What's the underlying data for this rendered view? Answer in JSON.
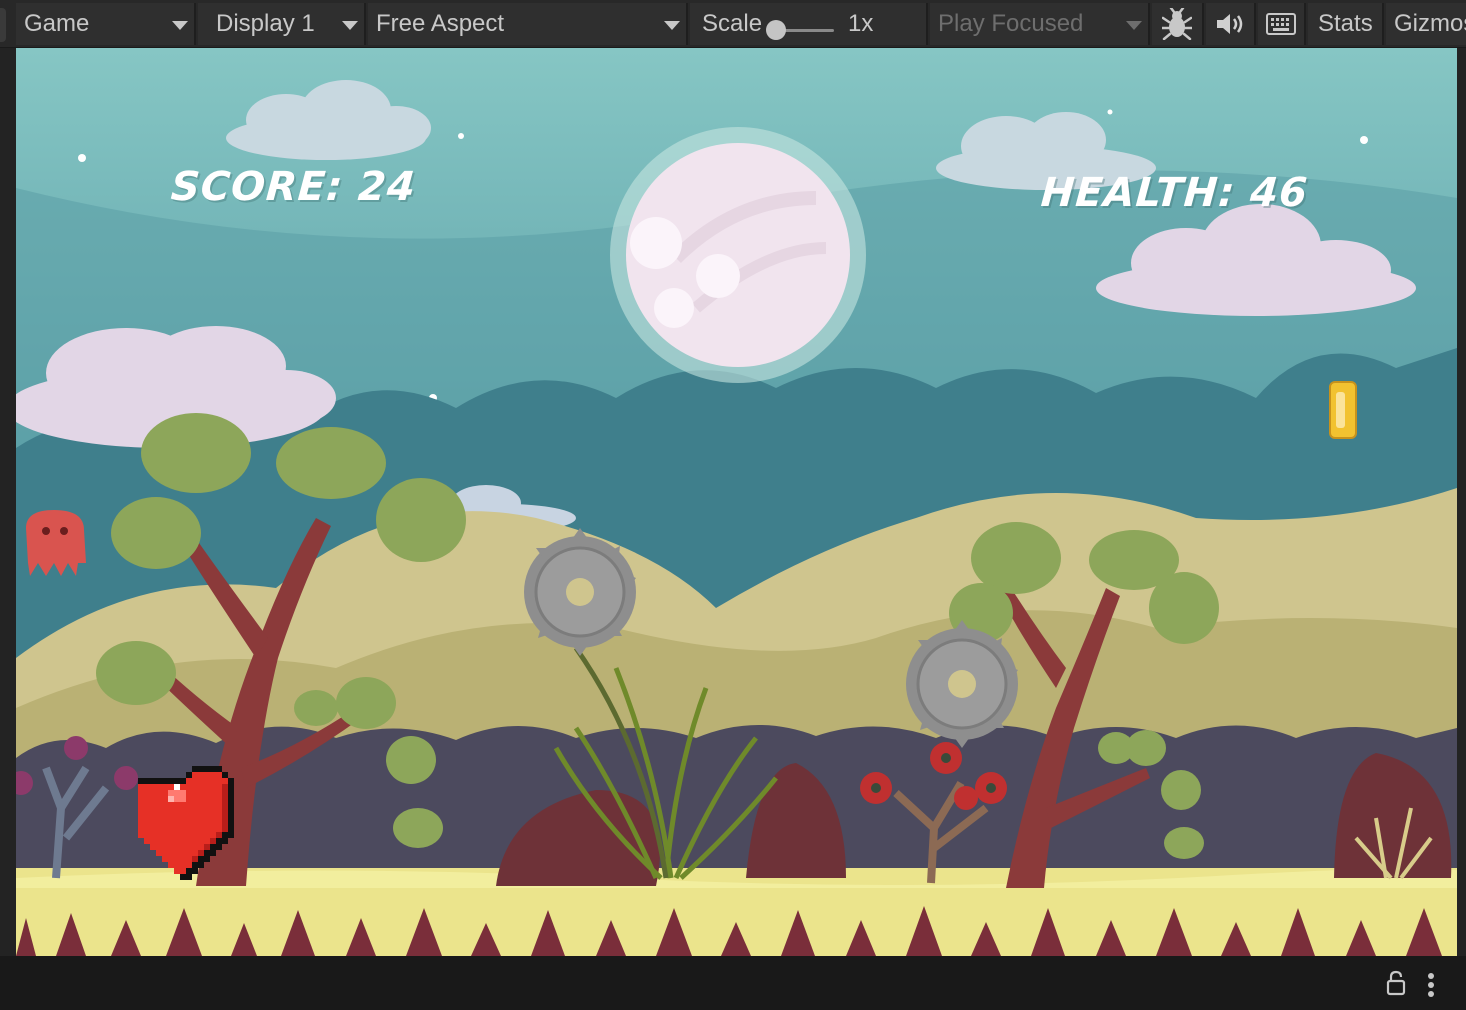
{
  "toolbar": {
    "view_tab": "Game",
    "display": "Display 1",
    "aspect": "Free Aspect",
    "scale_label": "Scale",
    "scale_value": "1x",
    "play_mode": "Play Focused",
    "stats": "Stats",
    "gizmos": "Gizmos"
  },
  "game": {
    "score_text": "SCORE: 24",
    "health_text": "HEALTH: 46"
  },
  "icons": {
    "bug": "bug-icon",
    "audio": "speaker-icon",
    "keyboard": "keyboard-icon",
    "lock": "lock-icon",
    "more": "more-vertical-icon"
  },
  "colors": {
    "sky": "#80c2c2",
    "heart": "#e63026",
    "coin": "#f2c230",
    "enemy": "#d9544f"
  }
}
